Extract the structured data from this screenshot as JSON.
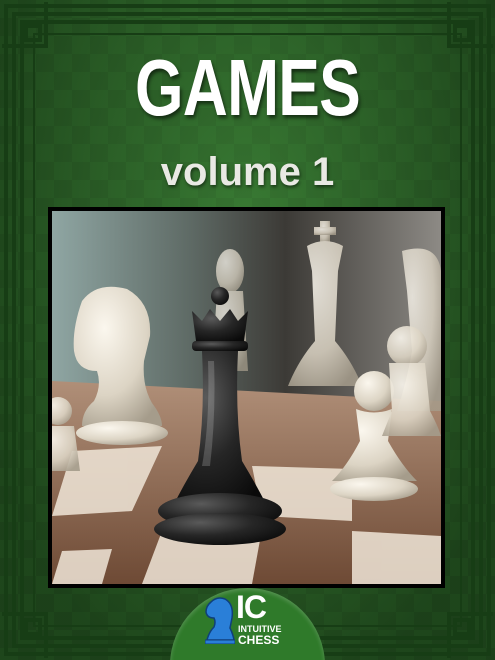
{
  "cover": {
    "title": "GAMES",
    "subtitle": "volume 1",
    "logo": {
      "mark": "IC",
      "line1": "INTUITIVE",
      "line2": "CHESS"
    }
  },
  "colors": {
    "background_green": "#2e6b2a",
    "border_dark": "#173d15",
    "title_text": "#ffffff",
    "logo_blue": "#2a7fd8"
  },
  "icons": {
    "photo": "chess-pieces-photo",
    "logo": "knight-icon"
  }
}
